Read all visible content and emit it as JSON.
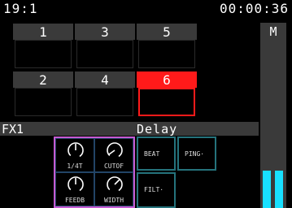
{
  "status": {
    "position": "19:1",
    "time": "00:00:36"
  },
  "pads": [
    {
      "label": "1",
      "active": false
    },
    {
      "label": "3",
      "active": false
    },
    {
      "label": "5",
      "active": false
    },
    {
      "label": "2",
      "active": false
    },
    {
      "label": "4",
      "active": false
    },
    {
      "label": "6",
      "active": true
    }
  ],
  "mixer": {
    "label": "M",
    "meters": [
      0.36,
      0.36
    ]
  },
  "fx": {
    "slot": "FX1",
    "effect": "Delay"
  },
  "knobs": [
    {
      "label": "1/4T",
      "value": 0.5
    },
    {
      "label": "CUTOF",
      "value": 0.1
    },
    {
      "label": "FEEDB",
      "value": 0.5
    },
    {
      "label": "WIDTH",
      "value": 0.8
    }
  ],
  "buttons": [
    {
      "label": "BEAT"
    },
    {
      "label": "PING·"
    },
    {
      "label": "FILT·"
    }
  ],
  "colors": {
    "active": "#ff1a1a",
    "meter": "#18e0ff",
    "knob_group": "#c65bd2",
    "button_border": "#25737c",
    "panel": "#3a3a3a"
  }
}
